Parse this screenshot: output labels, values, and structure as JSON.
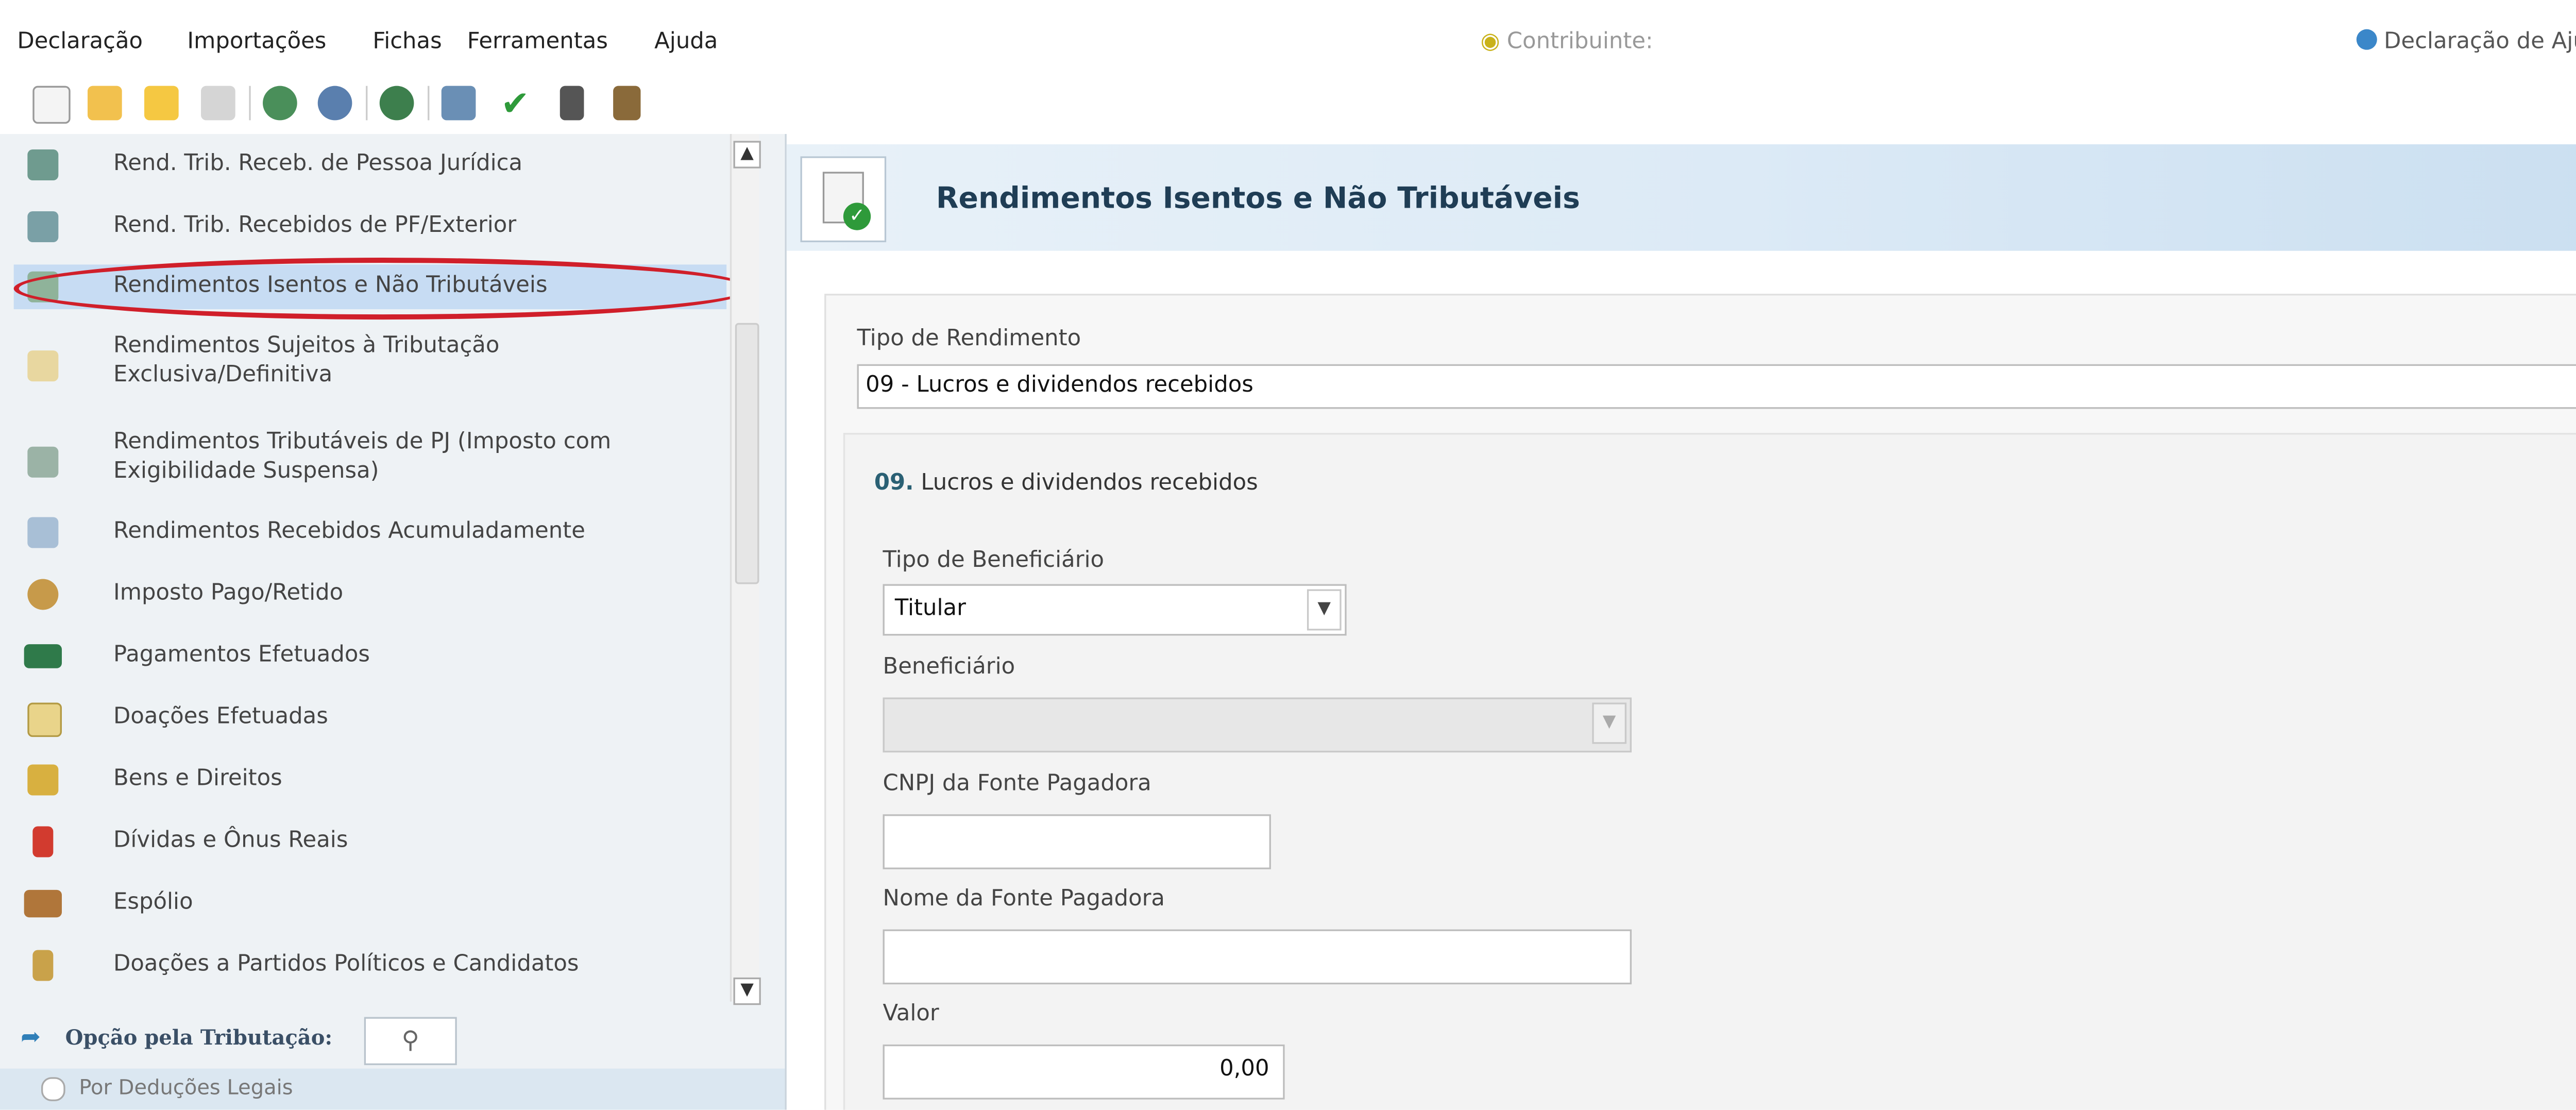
{
  "menubar": {
    "items": [
      "Declaração",
      "Importações",
      "Fichas",
      "Ferramentas",
      "Ajuda"
    ],
    "contribuinte_label": "Contribuinte:",
    "declaration_type": "Declaração de Ajuste"
  },
  "toolbar": {
    "icons": [
      "new-doc-icon",
      "open-folder-icon",
      "folder-icon",
      "trash-icon",
      "transmit-icon",
      "receive-icon",
      "globe-icon",
      "print-icon",
      "check-icon",
      "calculator-icon",
      "book-icon"
    ]
  },
  "sidebar": {
    "items": [
      {
        "label": "Rend. Trib. Receb. de Pessoa Jurídica",
        "icon": "income-pj-icon"
      },
      {
        "label": "Rend. Trib. Recebidos de PF/Exterior",
        "icon": "income-pf-icon"
      },
      {
        "label": "Rendimentos Isentos e Não Tributáveis",
        "icon": "exempt-income-icon"
      },
      {
        "label": "Rendimentos Sujeitos à Tributação",
        "label2": "Exclusiva/Definitiva",
        "icon": "exclusive-tax-icon"
      },
      {
        "label": "Rendimentos Tributáveis de PJ (Imposto com",
        "label2": "Exigibilidade Suspensa)",
        "icon": "suspended-tax-icon"
      },
      {
        "label": "Rendimentos Recebidos Acumuladamente",
        "icon": "accumulated-income-icon"
      },
      {
        "label": "Imposto Pago/Retido",
        "icon": "tax-paid-icon"
      },
      {
        "label": "Pagamentos Efetuados",
        "icon": "payments-icon"
      },
      {
        "label": "Doações Efetuadas",
        "icon": "donations-icon"
      },
      {
        "label": "Bens e Direitos",
        "icon": "assets-icon"
      },
      {
        "label": "Dívidas e Ônus Reais",
        "icon": "debts-icon"
      },
      {
        "label": "Espólio",
        "icon": "estate-icon"
      },
      {
        "label": "Doações a Partidos Políticos e Candidatos",
        "icon": "political-donations-icon"
      }
    ],
    "tax_option_label": "Opção pela Tributação:",
    "tax_option_value": "Por Deduções Legais"
  },
  "main": {
    "title": "Rendimentos Isentos e Não Tributáveis",
    "tipo_rendimento_label": "Tipo de Rendimento",
    "tipo_rendimento_value": "09 - Lucros e dividendos recebidos",
    "section_number": "09.",
    "section_title": " Lucros e dividendos recebidos",
    "tipo_beneficiario_label": "Tipo de Beneficiário",
    "tipo_beneficiario_value": "Titular",
    "beneficiario_label": "Beneficiário",
    "beneficiario_value": "",
    "cnpj_label": "CNPJ da Fonte Pagadora",
    "cnpj_value": "",
    "nome_fonte_label": "Nome da Fonte Pagadora",
    "nome_fonte_value": "",
    "valor_label": "Valor",
    "valor_value": "0,00"
  },
  "colors": {
    "highlight_ring": "#d01f2a",
    "sidebar_bg": "#eef2f5",
    "active_item": "#c7dcf3",
    "banner_title": "#1f3d55"
  }
}
